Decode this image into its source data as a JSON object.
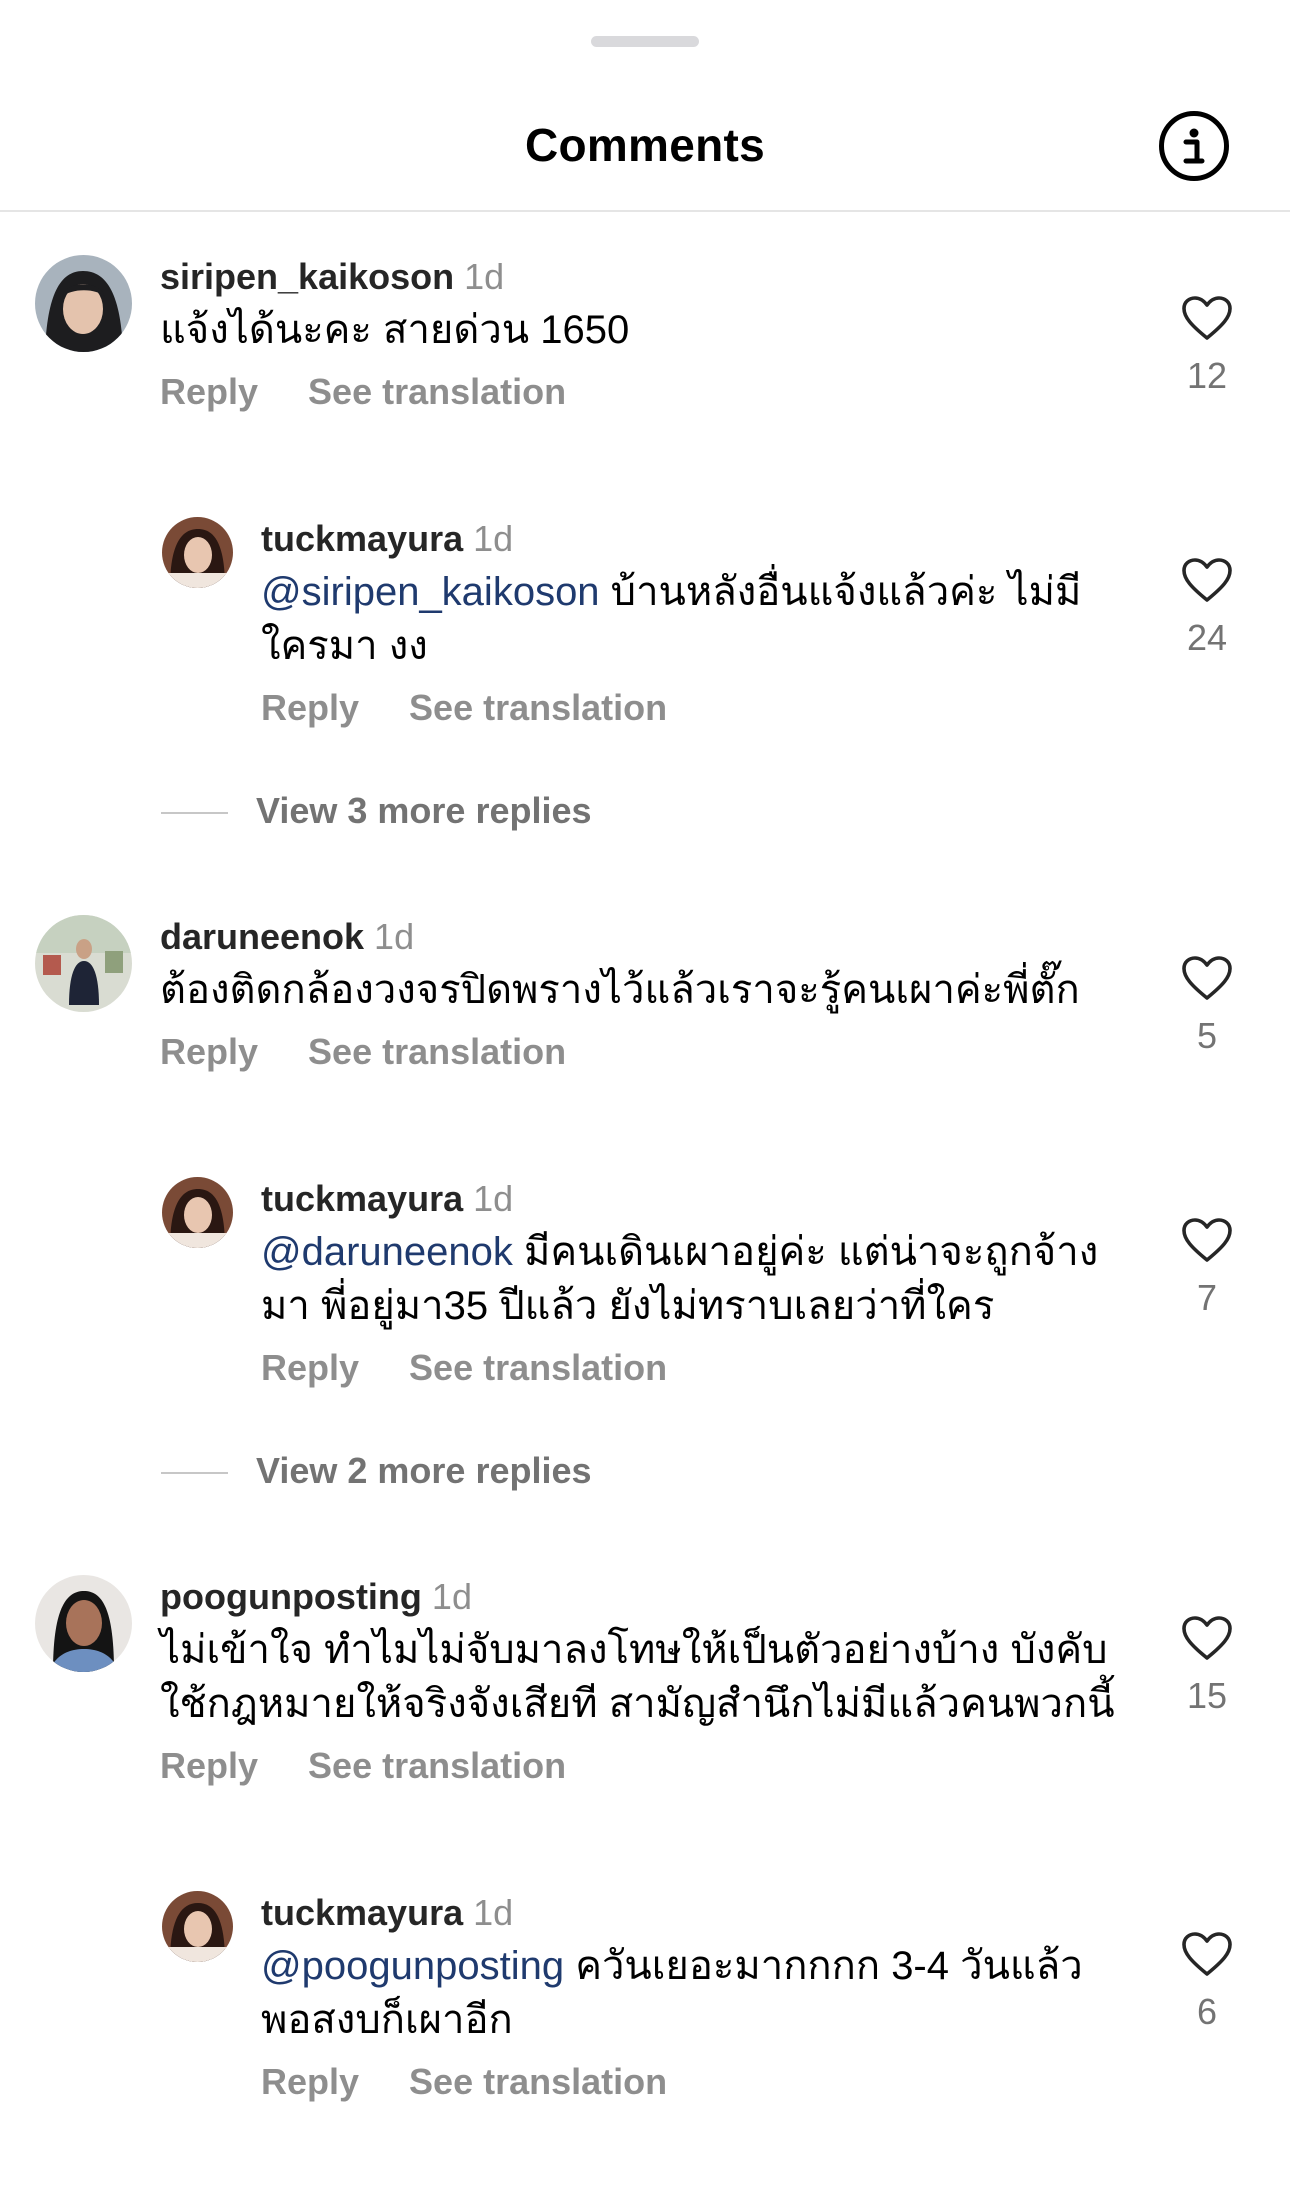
{
  "header": {
    "title": "Comments",
    "info_icon": "info-icon"
  },
  "comments": [
    {
      "username": "siripen_kaikoson",
      "time": "1d",
      "text": "แจ้งได้นะคะ สายด่วน 1650",
      "reply_label": "Reply",
      "translate_label": "See translation",
      "likes": "12",
      "avatar_colors": [
        "#3a3a3a",
        "#e7cbb8"
      ]
    },
    {
      "username": "tuckmayura",
      "time": "1d",
      "mention": "@siripen_kaikoson",
      "text": " บ้านหลังอื่นแจ้งแล้วค่ะ ไม่มีใครมา งง",
      "reply_label": "Reply",
      "translate_label": "See translation",
      "likes": "24"
    },
    {
      "username": "daruneenok",
      "time": "1d",
      "text": "ต้องติดกล้องวงจรปิดพรางไว้แล้วเราจะรู้คนเผาค่ะพี่ตั๊ก",
      "reply_label": "Reply",
      "translate_label": "See translation",
      "likes": "5"
    },
    {
      "username": "tuckmayura",
      "time": "1d",
      "mention": "@daruneenok",
      "text": " มีคนเดินเผาอยู่ค่ะ แต่น่าจะถูกจ้างมา พี่อยู่มา35 ปีแล้ว ยังไม่ทราบเลยว่าที่ใคร",
      "reply_label": "Reply",
      "translate_label": "See translation",
      "likes": "7"
    },
    {
      "username": "poogunposting",
      "time": "1d",
      "text": "ไม่เข้าใจ ทำไมไม่จับมาลงโทษให้เป็นตัวอย่างบ้าง บังคับใช้กฎหมายให้จริงจังเสียที สามัญสำนึกไม่มีแล้วคนพวกนี้",
      "reply_label": "Reply",
      "translate_label": "See translation",
      "likes": "15"
    },
    {
      "username": "tuckmayura",
      "time": "1d",
      "mention": "@poogunposting",
      "text": " ควันเยอะมากกกก 3-4 วันแล้ว พอสงบก็เผาอีก",
      "reply_label": "Reply",
      "translate_label": "See translation",
      "likes": "6"
    }
  ],
  "view_more": [
    "View 3 more replies",
    "View 2 more replies"
  ],
  "colors": {
    "mention": "#1f3a6e",
    "secondary": "#8e8e8e",
    "like_count": "#737373"
  }
}
